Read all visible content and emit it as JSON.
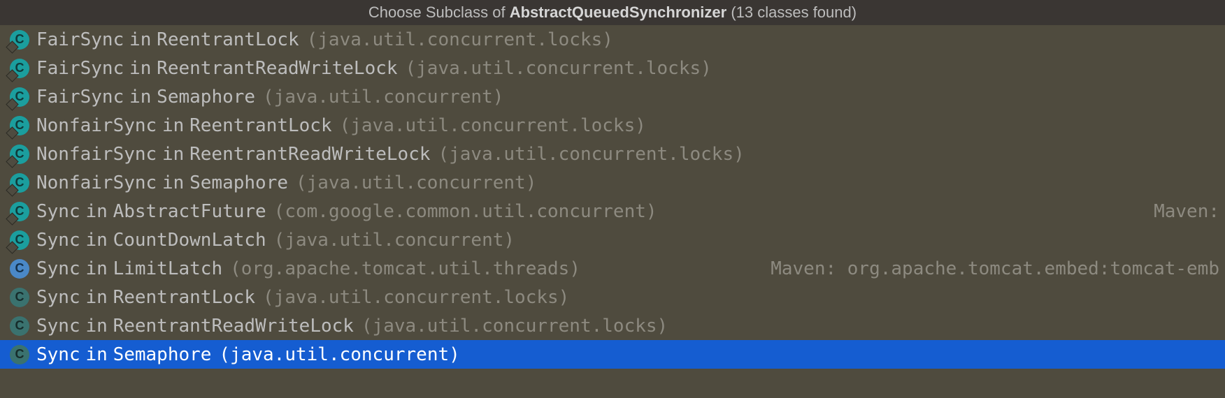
{
  "header": {
    "prefix": "Choose Subclass of ",
    "class_name": "AbstractQueuedSynchronizer",
    "suffix": " (13 classes found)"
  },
  "icon_letter": "C",
  "rows": [
    {
      "class_name": "FairSync",
      "in": "in",
      "enclosing": "ReentrantLock",
      "pkg": "(java.util.concurrent.locks)",
      "right": "",
      "icon": "teal",
      "final": true,
      "selected": false
    },
    {
      "class_name": "FairSync",
      "in": "in",
      "enclosing": "ReentrantReadWriteLock",
      "pkg": "(java.util.concurrent.locks)",
      "right": "",
      "icon": "teal",
      "final": true,
      "selected": false
    },
    {
      "class_name": "FairSync",
      "in": "in",
      "enclosing": "Semaphore",
      "pkg": "(java.util.concurrent)",
      "right": "",
      "icon": "teal",
      "final": true,
      "selected": false
    },
    {
      "class_name": "NonfairSync",
      "in": "in",
      "enclosing": "ReentrantLock",
      "pkg": "(java.util.concurrent.locks)",
      "right": "",
      "icon": "teal",
      "final": true,
      "selected": false
    },
    {
      "class_name": "NonfairSync",
      "in": "in",
      "enclosing": "ReentrantReadWriteLock",
      "pkg": "(java.util.concurrent.locks)",
      "right": "",
      "icon": "teal",
      "final": true,
      "selected": false
    },
    {
      "class_name": "NonfairSync",
      "in": "in",
      "enclosing": "Semaphore",
      "pkg": "(java.util.concurrent)",
      "right": "",
      "icon": "teal",
      "final": true,
      "selected": false
    },
    {
      "class_name": "Sync",
      "in": "in",
      "enclosing": "AbstractFuture",
      "pkg": "(com.google.common.util.concurrent)",
      "right": "Maven:",
      "icon": "teal",
      "final": true,
      "selected": false
    },
    {
      "class_name": "Sync",
      "in": "in",
      "enclosing": "CountDownLatch",
      "pkg": "(java.util.concurrent)",
      "right": "",
      "icon": "teal",
      "final": true,
      "selected": false
    },
    {
      "class_name": "Sync",
      "in": "in",
      "enclosing": "LimitLatch",
      "pkg": "(org.apache.tomcat.util.threads)",
      "right": "Maven: org.apache.tomcat.embed:tomcat-emb",
      "icon": "blue",
      "final": false,
      "selected": false
    },
    {
      "class_name": "Sync",
      "in": "in",
      "enclosing": "ReentrantLock",
      "pkg": "(java.util.concurrent.locks)",
      "right": "",
      "icon": "dim",
      "final": false,
      "selected": false
    },
    {
      "class_name": "Sync",
      "in": "in",
      "enclosing": "ReentrantReadWriteLock",
      "pkg": "(java.util.concurrent.locks)",
      "right": "",
      "icon": "dim",
      "final": false,
      "selected": false
    },
    {
      "class_name": "Sync",
      "in": "in",
      "enclosing": "Semaphore",
      "pkg": "(java.util.concurrent)",
      "right": "",
      "icon": "dim",
      "final": false,
      "selected": true
    }
  ]
}
